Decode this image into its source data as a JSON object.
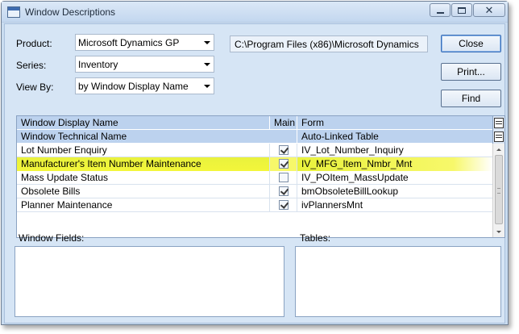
{
  "window": {
    "title": "Window Descriptions"
  },
  "title_controls": {
    "minimize": "minimize-icon",
    "maximize": "maximize-icon",
    "close": "close-icon",
    "close_glyph": "✕"
  },
  "filters": {
    "product_label": "Product:",
    "product_value": "Microsoft Dynamics GP",
    "series_label": "Series:",
    "series_value": "Inventory",
    "view_by_label": "View By:",
    "view_by_value": "by Window Display Name",
    "path": "C:\\Program Files (x86)\\Microsoft Dynamics"
  },
  "buttons": {
    "close": "Close",
    "print": "Print...",
    "find": "Find"
  },
  "grid": {
    "headers": {
      "display_name": "Window Display Name",
      "main": "Main",
      "form": "Form",
      "technical_name": "Window Technical Name",
      "auto_linked_table": "Auto-Linked Table"
    },
    "rows": [
      {
        "name": "Lot Number Enquiry",
        "main": true,
        "form": "IV_Lot_Number_Inquiry",
        "highlighted": false
      },
      {
        "name": "Manufacturer's Item Number Maintenance",
        "main": true,
        "form": "IV_MFG_Item_Nmbr_Mnt",
        "highlighted": true
      },
      {
        "name": "Mass Update Status",
        "main": false,
        "form": "IV_POItem_MassUpdate",
        "highlighted": false
      },
      {
        "name": "Obsolete Bills",
        "main": true,
        "form": "bmObsoleteBillLookup",
        "highlighted": false
      },
      {
        "name": "Planner Maintenance",
        "main": true,
        "form": "ivPlannersMnt",
        "highlighted": false
      }
    ],
    "highlight_color": "#eef23c"
  },
  "panels": {
    "window_fields": "Window Fields:",
    "tables": "Tables:"
  },
  "colors": {
    "header_bg": "#bcd2ee",
    "window_bg": "#d6e5f5"
  }
}
